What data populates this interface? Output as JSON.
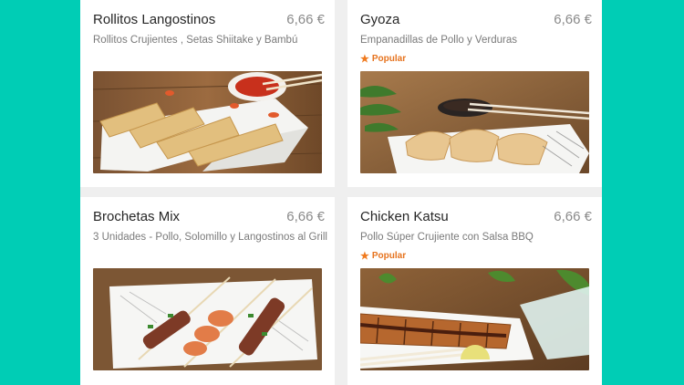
{
  "items": [
    {
      "name": "Rollitos Langostinos",
      "price": "6,66 €",
      "description": "Rollitos Crujientes , Setas Shiitake y Bambú",
      "popular": ""
    },
    {
      "name": "Gyoza",
      "price": "6,66 €",
      "description": "Empanadillas de Pollo y Verduras",
      "popular": "Popular"
    },
    {
      "name": "Brochetas Mix",
      "price": "6,66 €",
      "description": "3 Unidades - Pollo, Solomillo y Langostinos al Grill",
      "popular": ""
    },
    {
      "name": "Chicken Katsu",
      "price": "6,66 €",
      "description": "Pollo Súper Crujiente con Salsa BBQ",
      "popular": "Popular"
    }
  ],
  "colors": {
    "background": "#00cdb5",
    "panel": "#efefef",
    "card": "#ffffff",
    "popular": "#e6731e"
  },
  "icons": {
    "popular_badge": "star-icon"
  }
}
